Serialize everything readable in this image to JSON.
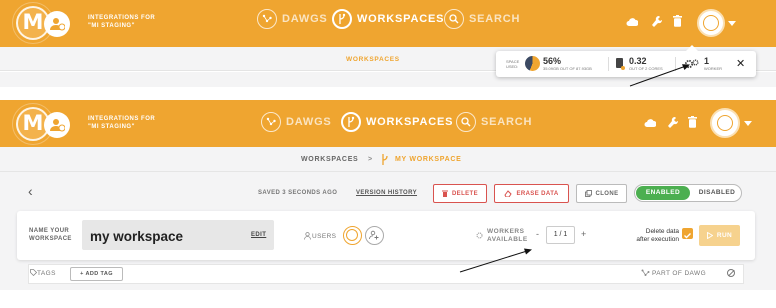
{
  "header": {
    "org_line1": "INTEGRATIONS FOR",
    "org_line2": "\"MI STAGING\"",
    "nav": [
      {
        "label": "DAWGS",
        "icon": "dawgs-icon",
        "active": false
      },
      {
        "label": "WORKSPACES",
        "icon": "workspaces-icon",
        "active": true
      },
      {
        "label": "SEARCH",
        "icon": "search-icon",
        "active": false
      }
    ],
    "right_icons": [
      "cloud-icon",
      "wrench-icon",
      "trash-icon",
      "profile-avatar",
      "chevron-down-icon"
    ]
  },
  "panel_top": {
    "breadcrumb": "WORKSPACES",
    "resources": {
      "space_label_1": "SPACE",
      "space_label_2": "USED:",
      "space_percent": "56%",
      "space_detail": "35.09GB OUT OF 87.93GB",
      "space_used_fraction": 0.56,
      "cores_value": "0.32",
      "cores_detail": "OUT OF 2 CORES",
      "workers_value": "1",
      "workers_label": "WORKER",
      "close_label": "✕"
    }
  },
  "panel_bottom": {
    "breadcrumb_root": "WORKSPACES",
    "breadcrumb_sep": ">",
    "breadcrumb_current": "MY WORKSPACE",
    "back_label": "‹",
    "saved_text": "SAVED 3 SECONDS AGO",
    "version_history": "VERSION HISTORY",
    "delete_label": "DELETE",
    "erase_label": "ERASE DATA",
    "clone_label": "CLONE",
    "enabled_label": "ENABLED",
    "disabled_label": "DISABLED",
    "name_label_1": "NAME YOUR",
    "name_label_2": "WORKSPACE",
    "workspace_name": "my workspace",
    "edit_label": "EDIT",
    "users_label": "USERS",
    "workers_label_1": "WORKERS",
    "workers_label_2": "AVAILABLE",
    "stepper_minus": "-",
    "stepper_value": "1 / 1",
    "stepper_plus": "+",
    "delete_after_1": "Delete data",
    "delete_after_2": "after execution",
    "run_label": "RUN",
    "tags_label": "TAGS",
    "add_tag_label": "+ ADD TAG",
    "part_of_dawg": "PART OF DAWG"
  },
  "colors": {
    "brand": "#efa530",
    "enabled": "#4caf50",
    "danger": "#d9534f",
    "dark": "#3c4a63"
  }
}
